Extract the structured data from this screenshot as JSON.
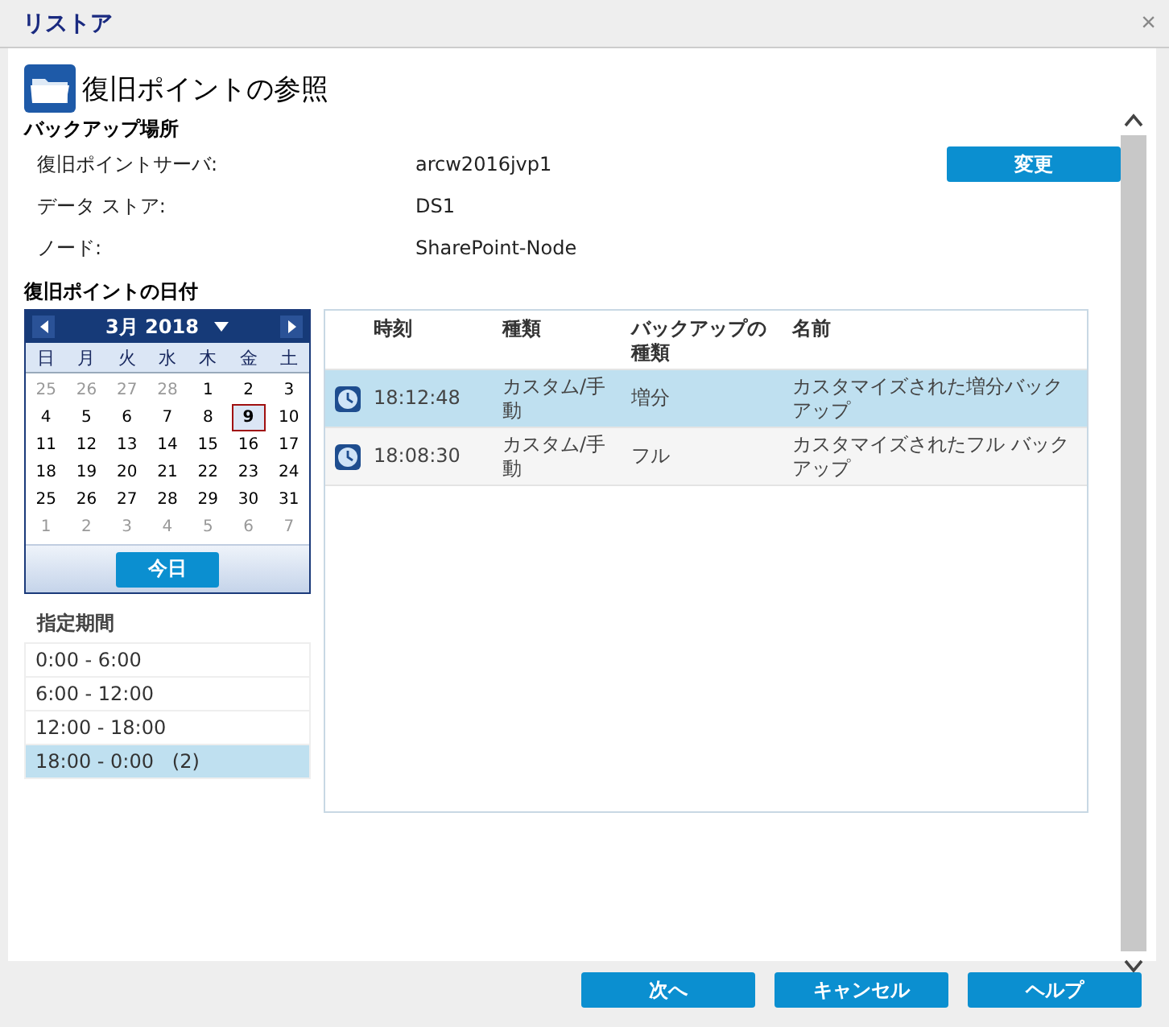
{
  "window": {
    "title": "リストア",
    "close": "×"
  },
  "page_title": "復旧ポイントの参照",
  "backup_location": {
    "heading": "バックアップ場所",
    "change_button": "変更",
    "fields": [
      {
        "label": "復旧ポイントサーバ:",
        "value": "arcw2016jvp1"
      },
      {
        "label": "データ ストア:",
        "value": "DS1"
      },
      {
        "label": "ノード:",
        "value": "SharePoint-Node"
      }
    ]
  },
  "date_heading": "復旧ポイントの日付",
  "calendar": {
    "month": "3月 2018",
    "weekdays": [
      "日",
      "月",
      "火",
      "水",
      "木",
      "金",
      "土"
    ],
    "days": [
      {
        "label": "25",
        "muted": true,
        "selected": false
      },
      {
        "label": "26",
        "muted": true,
        "selected": false
      },
      {
        "label": "27",
        "muted": true,
        "selected": false
      },
      {
        "label": "28",
        "muted": true,
        "selected": false
      },
      {
        "label": "1",
        "muted": false,
        "selected": false
      },
      {
        "label": "2",
        "muted": false,
        "selected": false
      },
      {
        "label": "3",
        "muted": false,
        "selected": false
      },
      {
        "label": "4",
        "muted": false,
        "selected": false
      },
      {
        "label": "5",
        "muted": false,
        "selected": false
      },
      {
        "label": "6",
        "muted": false,
        "selected": false
      },
      {
        "label": "7",
        "muted": false,
        "selected": false
      },
      {
        "label": "8",
        "muted": false,
        "selected": false
      },
      {
        "label": "9",
        "muted": false,
        "selected": true
      },
      {
        "label": "10",
        "muted": false,
        "selected": false
      },
      {
        "label": "11",
        "muted": false,
        "selected": false
      },
      {
        "label": "12",
        "muted": false,
        "selected": false
      },
      {
        "label": "13",
        "muted": false,
        "selected": false
      },
      {
        "label": "14",
        "muted": false,
        "selected": false
      },
      {
        "label": "15",
        "muted": false,
        "selected": false
      },
      {
        "label": "16",
        "muted": false,
        "selected": false
      },
      {
        "label": "17",
        "muted": false,
        "selected": false
      },
      {
        "label": "18",
        "muted": false,
        "selected": false
      },
      {
        "label": "19",
        "muted": false,
        "selected": false
      },
      {
        "label": "20",
        "muted": false,
        "selected": false
      },
      {
        "label": "21",
        "muted": false,
        "selected": false
      },
      {
        "label": "22",
        "muted": false,
        "selected": false
      },
      {
        "label": "23",
        "muted": false,
        "selected": false
      },
      {
        "label": "24",
        "muted": false,
        "selected": false
      },
      {
        "label": "25",
        "muted": false,
        "selected": false
      },
      {
        "label": "26",
        "muted": false,
        "selected": false
      },
      {
        "label": "27",
        "muted": false,
        "selected": false
      },
      {
        "label": "28",
        "muted": false,
        "selected": false
      },
      {
        "label": "29",
        "muted": false,
        "selected": false
      },
      {
        "label": "30",
        "muted": false,
        "selected": false
      },
      {
        "label": "31",
        "muted": false,
        "selected": false
      },
      {
        "label": "1",
        "muted": true,
        "selected": false
      },
      {
        "label": "2",
        "muted": true,
        "selected": false
      },
      {
        "label": "3",
        "muted": true,
        "selected": false
      },
      {
        "label": "4",
        "muted": true,
        "selected": false
      },
      {
        "label": "5",
        "muted": true,
        "selected": false
      },
      {
        "label": "6",
        "muted": true,
        "selected": false
      },
      {
        "label": "7",
        "muted": true,
        "selected": false
      }
    ],
    "today_button": "今日"
  },
  "period": {
    "heading": "指定期間",
    "items": [
      {
        "label": "0:00 - 6:00",
        "selected": false
      },
      {
        "label": "6:00 - 12:00",
        "selected": false
      },
      {
        "label": "12:00 - 18:00",
        "selected": false
      },
      {
        "label": "18:00 - 0:00   (2)",
        "selected": true
      }
    ]
  },
  "table": {
    "columns": [
      "時刻",
      "種類",
      "バックアップの種類",
      "名前"
    ],
    "rows": [
      {
        "time": "18:12:48",
        "type": "カスタム/手動",
        "backup_type": "増分",
        "name": "カスタマイズされた増分バックアップ",
        "selected": true
      },
      {
        "time": "18:08:30",
        "type": "カスタム/手動",
        "backup_type": "フル",
        "name": "カスタマイズされたフル バックアップ",
        "selected": false
      }
    ]
  },
  "buttons": [
    "次へ",
    "キャンセル",
    "ヘルプ"
  ]
}
